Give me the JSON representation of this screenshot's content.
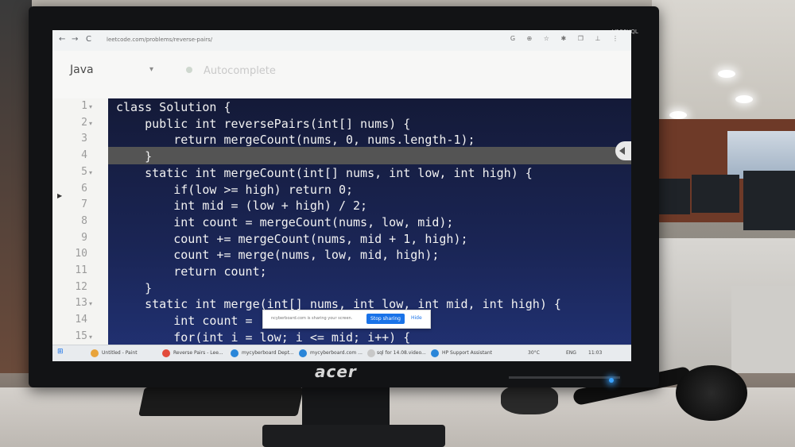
{
  "monitor": {
    "brand": "acer",
    "model": "V186HQL"
  },
  "browser": {
    "url": "leetcode.com/problems/reverse-pairs/",
    "nav_back": "←",
    "nav_forward": "→",
    "nav_reload": "C",
    "toolbar_icons": "G ⊕ ☆ ✱ ❐ ⊥ ⋮"
  },
  "editor": {
    "language": "Java",
    "language_arrow": "▾",
    "autocomplete_label": "Autocomplete",
    "line_numbers": [
      "1",
      "2",
      "3",
      "4",
      "5",
      "6",
      "7",
      "8",
      "9",
      "10",
      "11",
      "12",
      "13",
      "14",
      "15"
    ],
    "code_lines": [
      "class Solution {",
      "    public int reversePairs(int[] nums) {",
      "        return mergeCount(nums, 0, nums.length-1);",
      "    }",
      "    static int mergeCount(int[] nums, int low, int high) {",
      "        if(low >= high) return 0;",
      "        int mid = (low + high) / 2;",
      "        int count = mergeCount(nums, low, mid);",
      "        count += mergeCount(nums, mid + 1, high);",
      "        count += merge(nums, low, mid, high);",
      "        return count;",
      "    }",
      "    static int merge(int[] nums, int low, int mid, int high) {",
      "        int count = ",
      "        for(int i = low; i <= mid; i++) {"
    ]
  },
  "notification": {
    "text": "ncyberboard.com is sharing your screen.",
    "stop_button": "Stop sharing",
    "hide_link": "Hide"
  },
  "taskbar": {
    "items": [
      "Untitled - Paint",
      "Reverse Pairs - Lee...",
      "mycyberboard Dept...",
      "mycyberboard.com ...",
      "sql for 14.08.video...",
      "HP Support Assistant"
    ],
    "weather": "30°C",
    "lang": "ENG",
    "time": "11:03"
  }
}
